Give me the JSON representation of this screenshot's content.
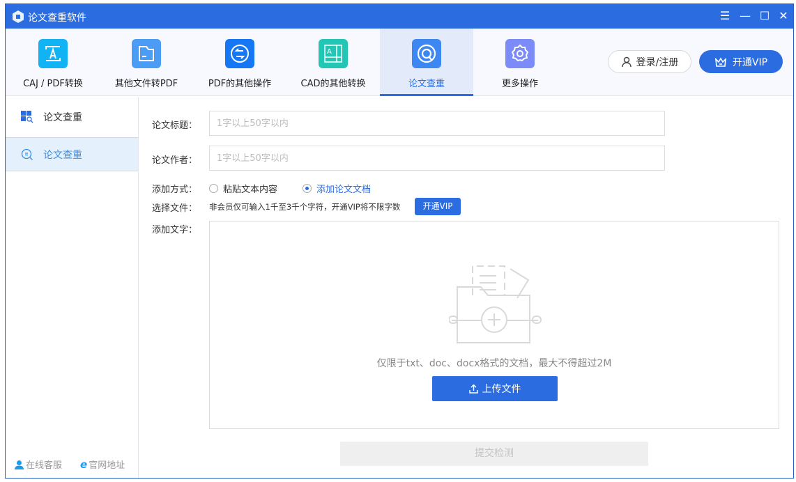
{
  "window": {
    "title": "论文查重软件"
  },
  "tabs": [
    {
      "label": "CAJ / PDF转换",
      "color": "#12b3f5"
    },
    {
      "label": "其他文件转PDF",
      "color": "#4a9cf5"
    },
    {
      "label": "PDF的其他操作",
      "color": "#1677f5"
    },
    {
      "label": "CAD的其他转换",
      "color": "#22c6b4"
    },
    {
      "label": "论文查重",
      "color": "#3d87f2"
    },
    {
      "label": "更多操作",
      "color": "#7b8cf8"
    }
  ],
  "header": {
    "login": "登录/注册",
    "vip": "开通VIP"
  },
  "sidebar": {
    "items": [
      {
        "label": "论文查重"
      },
      {
        "label": "论文查重"
      }
    ],
    "footer": {
      "service": "在线客服",
      "website": "官网地址"
    }
  },
  "form": {
    "title_label": "论文标题：",
    "title_placeholder": "1字以上50字以内",
    "author_label": "论文作者：",
    "author_placeholder": "1字以上50字以内",
    "method_label": "添加方式：",
    "method_options": [
      "粘贴文本内容",
      "添加论文文档"
    ],
    "file_label": "选择文件：",
    "file_note": "非会员仅可输入1千至3千个字符，开通VIP将不限字数",
    "vip_button": "开通VIP",
    "text_label": "添加文字：",
    "hint": "仅限于txt、doc、docx格式的文档，最大不得超过2M",
    "upload": "上传文件",
    "submit": "提交检测"
  }
}
